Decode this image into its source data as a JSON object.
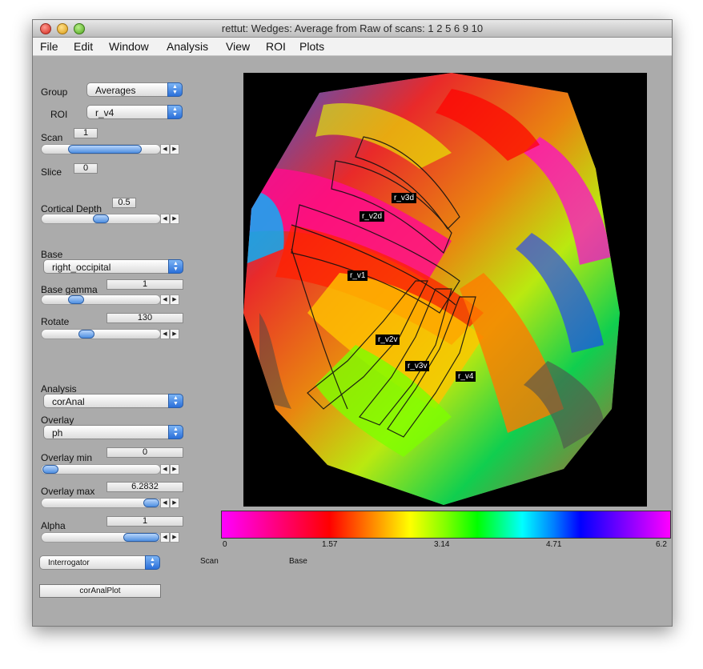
{
  "window": {
    "title": "rettut: Wedges: Average from Raw of scans: 1   2   5   6   9  10"
  },
  "menu": [
    "File",
    "Edit",
    "Window",
    "Analysis",
    "View",
    "ROI",
    "Plots"
  ],
  "controls": {
    "group": {
      "label": "Group",
      "value": "Averages"
    },
    "roi": {
      "label": "ROI",
      "value": "r_v4"
    },
    "scan": {
      "label": "Scan",
      "value": "1",
      "slider_fraction": 0.6
    },
    "slice": {
      "label": "Slice",
      "value": "0"
    },
    "cortical_depth": {
      "label": "Cortical Depth",
      "value": "0.5",
      "slider_fraction": 0.5
    },
    "base": {
      "label": "Base",
      "value": "right_occipital"
    },
    "base_gamma": {
      "label": "Base gamma",
      "value": "1",
      "slider_fraction": 0.25
    },
    "rotate": {
      "label": "Rotate",
      "value": "130",
      "slider_fraction": 0.36
    },
    "analysis": {
      "label": "Analysis",
      "value": "corAnal"
    },
    "overlay": {
      "label": "Overlay",
      "value": "ph"
    },
    "overlay_min": {
      "label": "Overlay min",
      "value": "0",
      "slider_fraction": 0.0
    },
    "overlay_max": {
      "label": "Overlay max",
      "value": "6.2832",
      "slider_fraction": 1.0
    },
    "alpha": {
      "label": "Alpha",
      "value": "1",
      "slider_fraction": 1.0
    },
    "interrogator": {
      "value": "Interrogator"
    },
    "coranalplot_button": "corAnalPlot",
    "scan_caption": "Scan",
    "base_caption": "Base"
  },
  "roi_labels": [
    "r_v3d",
    "r_v2d",
    "r_v1",
    "r_v2v",
    "r_v3v",
    "r_v4"
  ],
  "colorbar": {
    "ticks": [
      "0",
      "1.57",
      "3.14",
      "4.71",
      "6.2"
    ]
  },
  "icons": {
    "slider_left": "◂",
    "slider_right": "▸",
    "popup_arrows": "▲▼"
  }
}
